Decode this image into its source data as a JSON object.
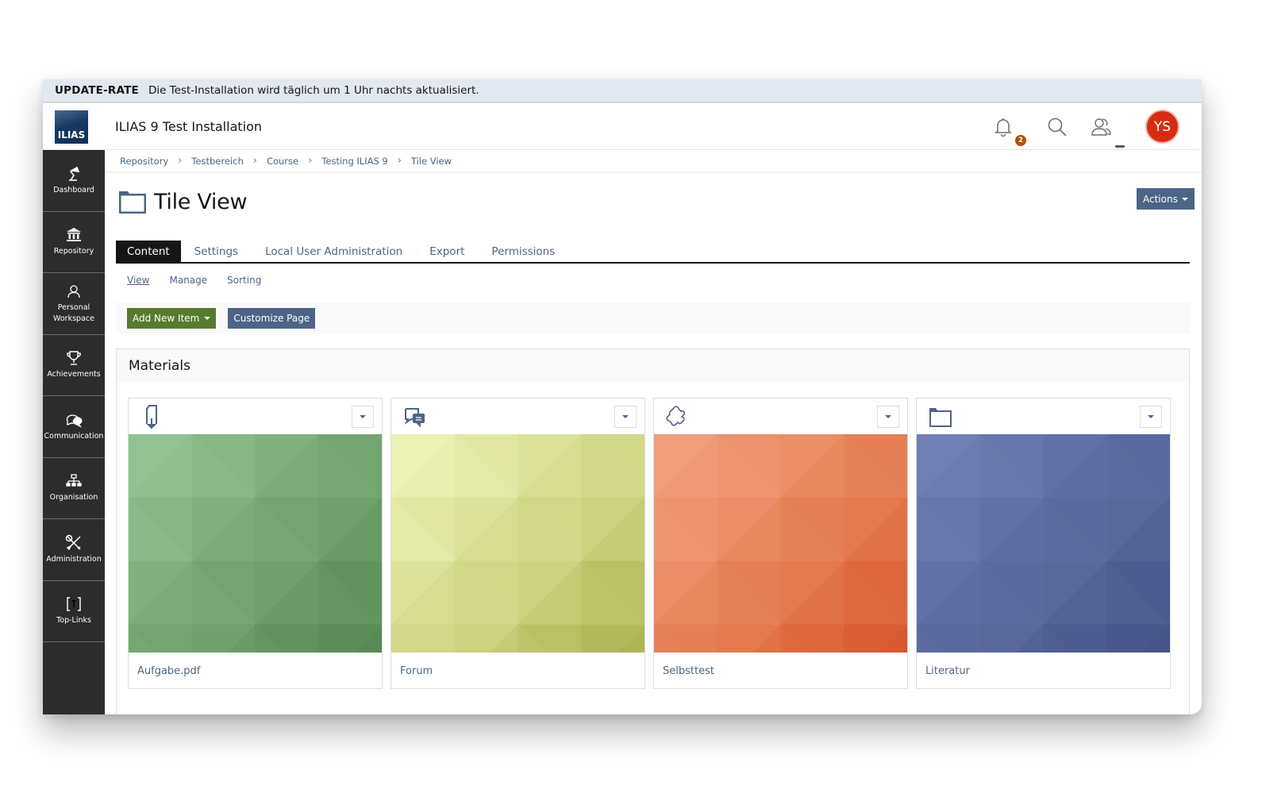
{
  "banner": {
    "title": "UPDATE-RATE",
    "message": "Die Test-Installation wird täglich um 1 Uhr nachts aktualisiert."
  },
  "header": {
    "logo_text": "ILIAS",
    "app_title": "ILIAS 9 Test Installation",
    "notification_count": "2",
    "avatar_initials": "YS",
    "icons": [
      "bell-icon",
      "search-icon",
      "users-icon"
    ]
  },
  "sidebar": {
    "items": [
      {
        "label": "Dashboard",
        "icon": "desk-lamp-icon"
      },
      {
        "label": "Repository",
        "icon": "bank-icon"
      },
      {
        "label": "Personal Workspace",
        "icon": "person-icon"
      },
      {
        "label": "Achievements",
        "icon": "trophy-icon"
      },
      {
        "label": "Communication",
        "icon": "chat-bubbles-icon"
      },
      {
        "label": "Organisation",
        "icon": "org-chart-icon"
      },
      {
        "label": "Administration",
        "icon": "tools-icon"
      },
      {
        "label": "Top-Links",
        "icon": "bracket-t-icon"
      }
    ]
  },
  "breadcrumb": [
    "Repository",
    "Testbereich",
    "Course",
    "Testing ILIAS 9",
    "Tile View"
  ],
  "page": {
    "title": "Tile View",
    "actions_label": "Actions"
  },
  "tabs": [
    "Content",
    "Settings",
    "Local User Administration",
    "Export",
    "Permissions"
  ],
  "active_tab": "Content",
  "subtabs": [
    "View",
    "Manage",
    "Sorting"
  ],
  "active_subtab": "View",
  "toolbar": {
    "add_new_item": "Add New Item",
    "customize_page": "Customize Page"
  },
  "materials": {
    "title": "Materials",
    "tiles": [
      {
        "title": "Aufgabe.pdf",
        "icon": "file-download-icon",
        "colors": [
          "#93c292",
          "#7eaf7a",
          "#6d9d68",
          "#5a8a55"
        ]
      },
      {
        "title": "Forum",
        "icon": "forum-icon",
        "colors": [
          "#ecf2b6",
          "#d9df94",
          "#c9d07c",
          "#adb655"
        ]
      },
      {
        "title": "Selbsttest",
        "icon": "puzzle-icon",
        "colors": [
          "#ef9e7c",
          "#ea8a62",
          "#e3774b",
          "#d9582e"
        ]
      },
      {
        "title": "Literatur",
        "icon": "folder-icon",
        "colors": [
          "#7080b4",
          "#6070a6",
          "#566699",
          "#45558a"
        ]
      }
    ]
  }
}
